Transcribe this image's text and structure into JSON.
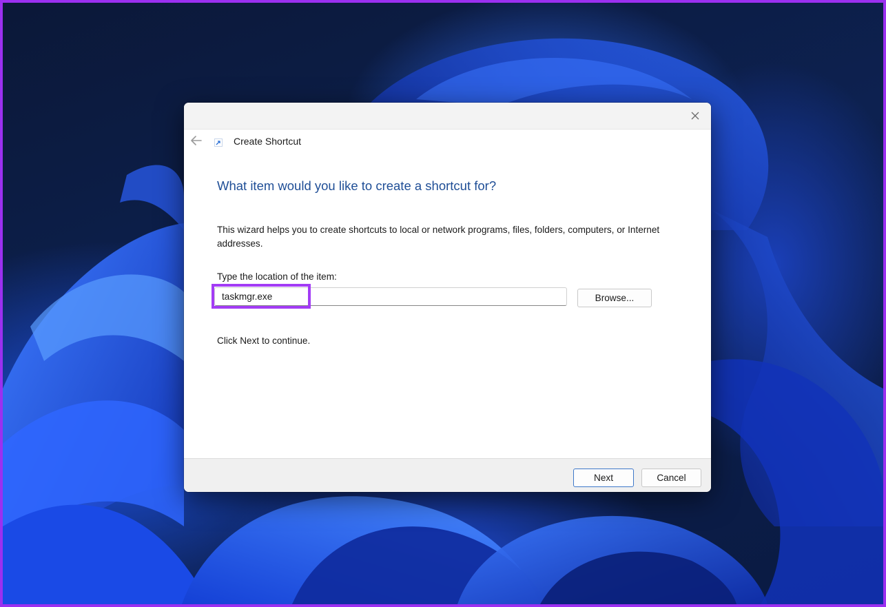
{
  "dialog": {
    "title": "Create Shortcut",
    "heading": "What item would you like to create a shortcut for?",
    "description": "This wizard helps you to create shortcuts to local or network programs, files, folders, computers, or Internet addresses.",
    "location_label": "Type the location of the item:",
    "location_value": "taskmgr.exe",
    "browse_label": "Browse...",
    "continue_text": "Click Next to continue.",
    "next_label": "Next",
    "cancel_label": "Cancel"
  },
  "icons": {
    "close": "close-icon",
    "back": "back-arrow-icon",
    "wizard": "shortcut-icon"
  },
  "colors": {
    "frame_highlight": "#a33cf5",
    "heading": "#1f4e96",
    "primary_button_border": "#3d78c9"
  }
}
